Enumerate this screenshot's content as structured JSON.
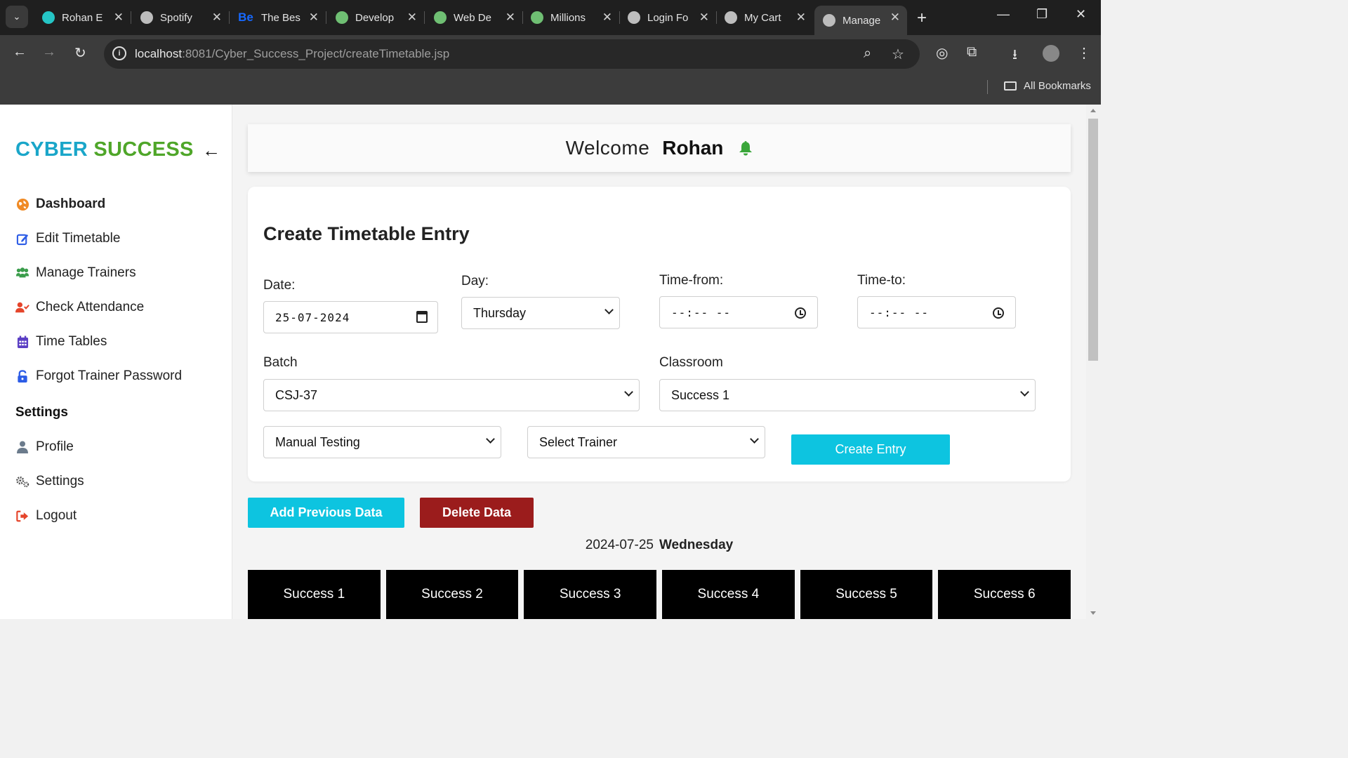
{
  "browser": {
    "tabs": [
      {
        "title": "Rohan E",
        "icon": "app-icon",
        "color": "#25c5c5"
      },
      {
        "title": "Spotify",
        "icon": "globe-icon",
        "color": "#bdbdbd"
      },
      {
        "title": "The Bes",
        "icon": "behance-icon",
        "color": "#1769ff"
      },
      {
        "title": "Develop",
        "icon": "leaf-icon",
        "color": "#6fbf73"
      },
      {
        "title": "Web De",
        "icon": "leaf-icon",
        "color": "#6fbf73"
      },
      {
        "title": "Millions",
        "icon": "leaf-icon",
        "color": "#6fbf73"
      },
      {
        "title": "Login Fo",
        "icon": "globe-icon",
        "color": "#bdbdbd"
      },
      {
        "title": "My Cart",
        "icon": "globe-icon",
        "color": "#bdbdbd"
      },
      {
        "title": "Manage",
        "icon": "globe-icon",
        "color": "#bdbdbd",
        "active": true
      }
    ],
    "url_host": "localhost",
    "url_path": ":8081/Cyber_Success_Project/createTimetable.jsp",
    "bookmarks_label": "All Bookmarks"
  },
  "sidebar": {
    "brand_part1": "CYBER",
    "brand_part2": "SUCCESS",
    "items": [
      {
        "label": "Dashboard",
        "icon": "globe-icon",
        "color": "#f08a24"
      },
      {
        "label": "Edit Timetable",
        "icon": "edit-icon",
        "color": "#2c5ce6"
      },
      {
        "label": "Manage Trainers",
        "icon": "users-icon",
        "color": "#3a9d4b"
      },
      {
        "label": "Check Attendance",
        "icon": "user-check-icon",
        "color": "#e5452b"
      },
      {
        "label": "Time Tables",
        "icon": "calendar-icon",
        "color": "#5b3fc4"
      },
      {
        "label": "Forgot Trainer Password",
        "icon": "lock-icon",
        "color": "#2c5ce6"
      }
    ],
    "settings_heading": "Settings",
    "settings_items": [
      {
        "label": "Profile",
        "icon": "user-icon",
        "color": "#6b7b8c"
      },
      {
        "label": "Settings",
        "icon": "gears-icon",
        "color": "#555555"
      },
      {
        "label": "Logout",
        "icon": "logout-icon",
        "color": "#e5452b"
      }
    ]
  },
  "header": {
    "welcome": "Welcome",
    "user_name": "Rohan"
  },
  "form": {
    "title": "Create Timetable Entry",
    "date_label": "Date:",
    "date_value": "25-07-2024",
    "day_label": "Day:",
    "day_value": "Thursday",
    "time_from_label": "Time-from:",
    "time_from_value": "--:-- --",
    "time_to_label": "Time-to:",
    "time_to_value": "--:-- --",
    "batch_label": "Batch",
    "batch_value": "CSJ-37",
    "classroom_label": "Classroom",
    "classroom_value": "Success 1",
    "subject_value": "Manual Testing",
    "trainer_value": "Select Trainer",
    "create_button": "Create Entry"
  },
  "actions": {
    "add_previous": "Add Previous Data",
    "delete_data": "Delete Data"
  },
  "schedule": {
    "date": "2024-07-25",
    "day": "Wednesday",
    "rooms": [
      "Success 1",
      "Success 2",
      "Success 3",
      "Success 4",
      "Success 5",
      "Success 6"
    ]
  },
  "colors": {
    "brand_cyan": "#1aa6c9",
    "brand_green": "#4fa629",
    "button_cyan": "#0dc4e0",
    "button_danger": "#9b1c1c"
  }
}
